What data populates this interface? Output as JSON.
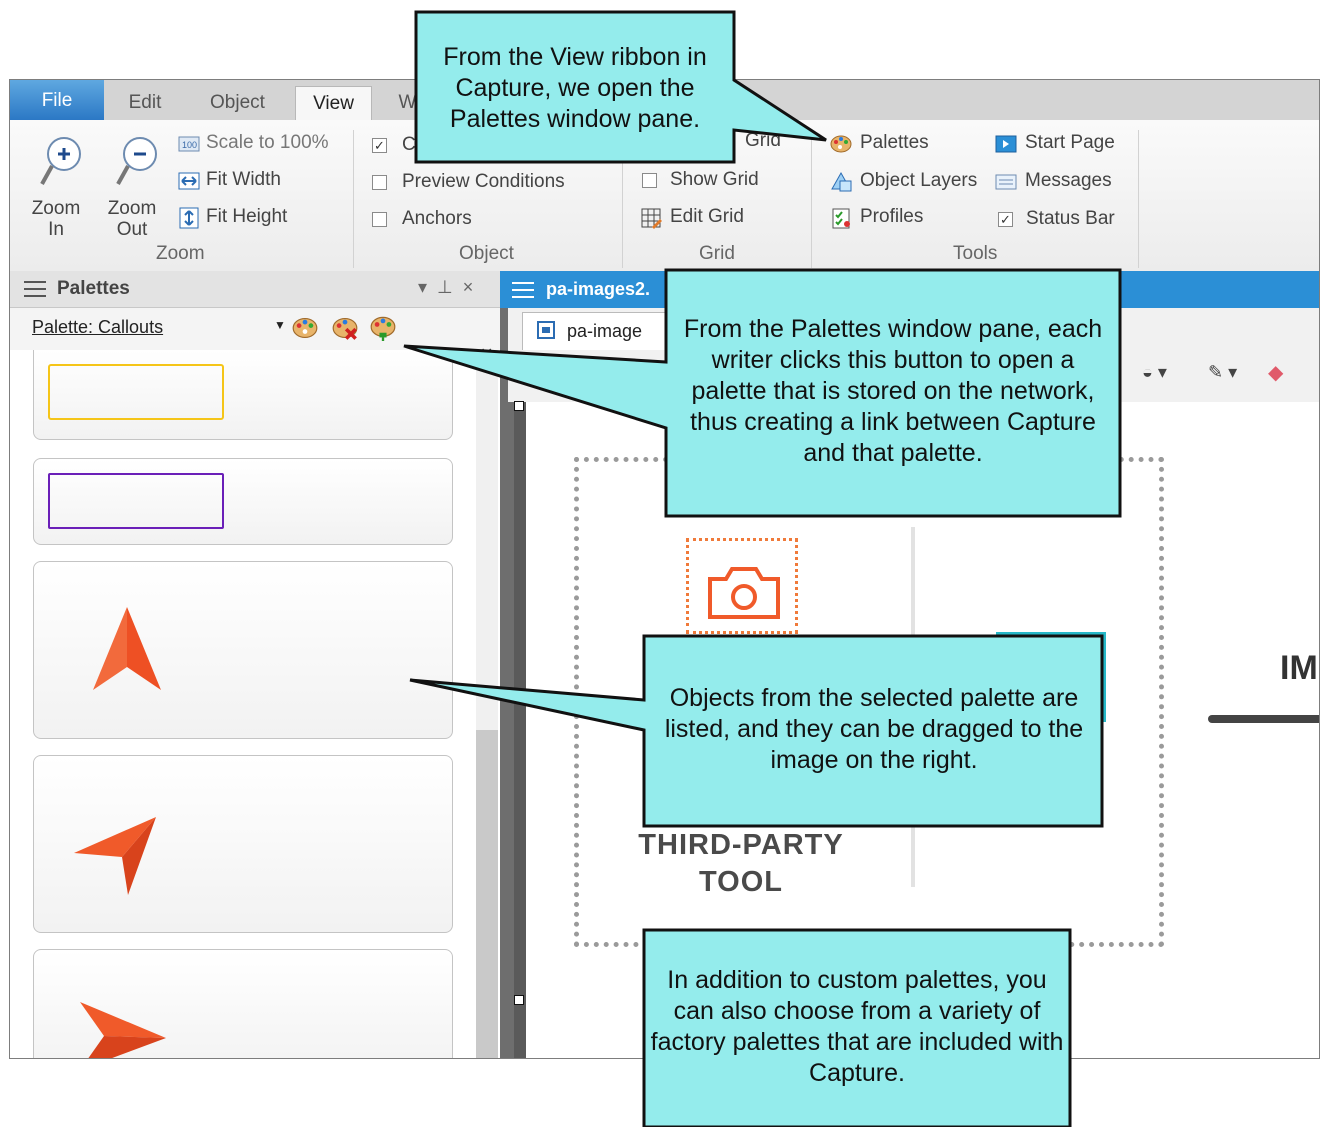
{
  "tabs": [
    "File",
    "Edit",
    "Object",
    "View",
    "W"
  ],
  "ribbon": {
    "zoom_in": [
      "Zoom",
      "In"
    ],
    "zoom_out": [
      "Zoom",
      "Out"
    ],
    "scale": "Scale to 100%",
    "fit_width": "Fit Width",
    "fit_height": "Fit Height",
    "obj_first": "C",
    "preview_conditions": "Preview Conditions",
    "anchors": "Anchors",
    "grid_top": "Grid",
    "show_grid": "Show Grid",
    "edit_grid": "Edit Grid",
    "palettes": "Palettes",
    "object_layers": "Object Layers",
    "profiles": "Profiles",
    "start_page": "Start Page",
    "messages": "Messages",
    "status_bar": "Status Bar",
    "groups": {
      "zoom": "Zoom",
      "object": "Object",
      "grid": "Grid",
      "tools": "Tools"
    }
  },
  "pane": {
    "title": "Palettes",
    "palette_label": "Palette: Callouts",
    "pin_glyph": "▾  ⊥  ×"
  },
  "doc": {
    "tab_title": "pa-images2.",
    "sub_tab": "pa-image",
    "image_text": [
      "THIRD-PARTY",
      "TOOL"
    ],
    "image_right": "IM"
  },
  "callouts": {
    "view": "From the View ribbon in Capture, we open the Palettes window pane.",
    "button": "From the Palettes window pane, each writer clicks this button to open a palette that is stored on the network, thus creating a link between Capture and that palette.",
    "objects": "Objects from the selected palette are listed, and they can be dragged to the image on the right.",
    "factory": "In addition to custom palettes, you can also choose from a variety of factory palettes that are included with Capture."
  },
  "colors": {
    "callout_fill": "#94ecec",
    "accent_orange": "#ee5024",
    "yellow": "#f5c518",
    "purple": "#6a1fb8",
    "blue": "#2b8fd6"
  }
}
